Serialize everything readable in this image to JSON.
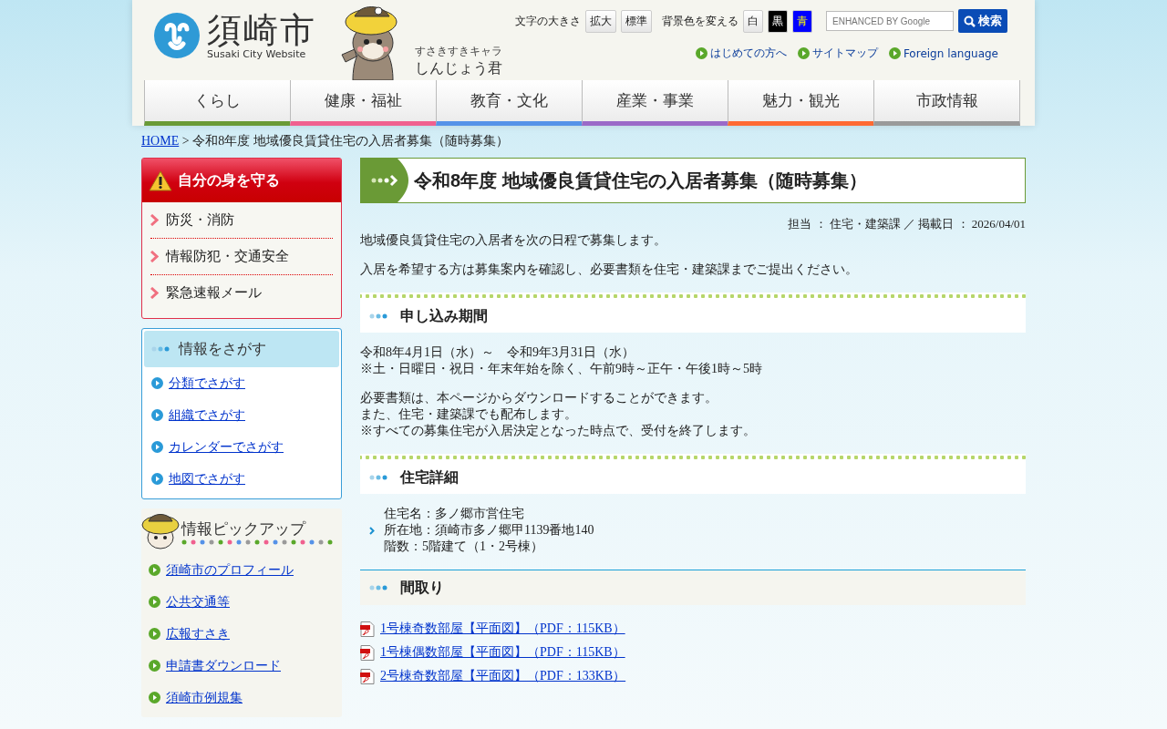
{
  "header": {
    "logo": {
      "name": "須崎市",
      "subtitle": "Susaki City Website"
    },
    "mascot": {
      "caption": "すさきすきキャラ",
      "name": "しんじょう君"
    },
    "font_size": {
      "label": "文字の大きさ",
      "buttons": [
        "拡大",
        "標準"
      ]
    },
    "bg_color": {
      "label": "背景色を変える",
      "buttons": [
        {
          "label": "白",
          "kind": "white"
        },
        {
          "label": "黒",
          "kind": "black"
        },
        {
          "label": "青",
          "kind": "blue"
        }
      ]
    },
    "search": {
      "placeholder": "ENHANCED BY Google",
      "button": "検索"
    },
    "links": [
      "はじめての方へ",
      "サイトマップ",
      "Foreign language"
    ],
    "nav": [
      {
        "label": "くらし",
        "color": "#6a9a36"
      },
      {
        "label": "健康・福祉",
        "color": "#f0608f"
      },
      {
        "label": "教育・文化",
        "color": "#5592e8"
      },
      {
        "label": "産業・事業",
        "color": "#9b6ac8"
      },
      {
        "label": "魅力・観光",
        "color": "#ff6a33"
      },
      {
        "label": "市政情報",
        "color": "#9a9a9a"
      }
    ]
  },
  "breadcrumb": {
    "home": "HOME",
    "separator": ">",
    "current": "令和8年度 地域優良賃貸住宅の入居者募集（随時募集）"
  },
  "sidebar": {
    "safety": {
      "title": "自分の身を守る",
      "items": [
        "防災・消防",
        "情報防犯・交通安全",
        "緊急速報メール"
      ]
    },
    "search_by": {
      "title": "情報をさがす",
      "items": [
        "分類でさがす",
        "組織でさがす",
        "カレンダーでさがす",
        "地図でさがす"
      ]
    },
    "pickup": {
      "title": "情報ピックアップ",
      "items": [
        "須崎市のプロフィール",
        "公共交通等",
        "広報すさき",
        "申請書ダウンロード",
        "須崎市例規集"
      ]
    }
  },
  "main": {
    "title": "令和8年度 地域優良賃貸住宅の入居者募集（随時募集）",
    "meta": "担当 ： 住宅・建築課 ／ 掲載日 ： 2026/04/01",
    "intro": [
      "地域優良賃貸住宅の入居者を次の日程で募集します。",
      "入居を希望する方は募集案内を確認し、必要書類を住宅・建築課までご提出ください。"
    ],
    "sections": [
      {
        "heading": "申し込み期間",
        "kind": "dotted",
        "blocks": [
          {
            "kind": "text",
            "lines": [
              "令和8年4月1日（水）～　令和9年3月31日（水）",
              "※土・日曜日・祝日・年末年始を除く、午前9時～正午・午後1時～5時"
            ]
          },
          {
            "kind": "text",
            "lines": [
              "必要書類は、本ページからダウンロードすることができます。",
              "また、住宅・建築課でも配布します。",
              "※すべての募集住宅が入居決定となった時点で、受付を終了します。"
            ]
          }
        ]
      },
      {
        "heading": "住宅詳細",
        "kind": "dotted",
        "blocks": [
          {
            "kind": "bullet",
            "lines": [
              "住宅名：多ノ郷市営住宅",
              "所在地：須崎市多ノ郷甲1139番地140",
              "階数：5階建て（1・2号棟）"
            ]
          }
        ]
      },
      {
        "heading": "間取り",
        "kind": "rule",
        "blocks": [
          {
            "kind": "pdf",
            "lines": [
              "1号棟奇数部屋【平面図】（PDF：115KB）"
            ]
          },
          {
            "kind": "pdf",
            "lines": [
              "1号棟偶数部屋【平面図】（PDF：115KB）"
            ]
          },
          {
            "kind": "pdf",
            "lines": [
              "2号棟奇数部屋【平面図】（PDF：133KB）"
            ]
          }
        ]
      }
    ]
  }
}
